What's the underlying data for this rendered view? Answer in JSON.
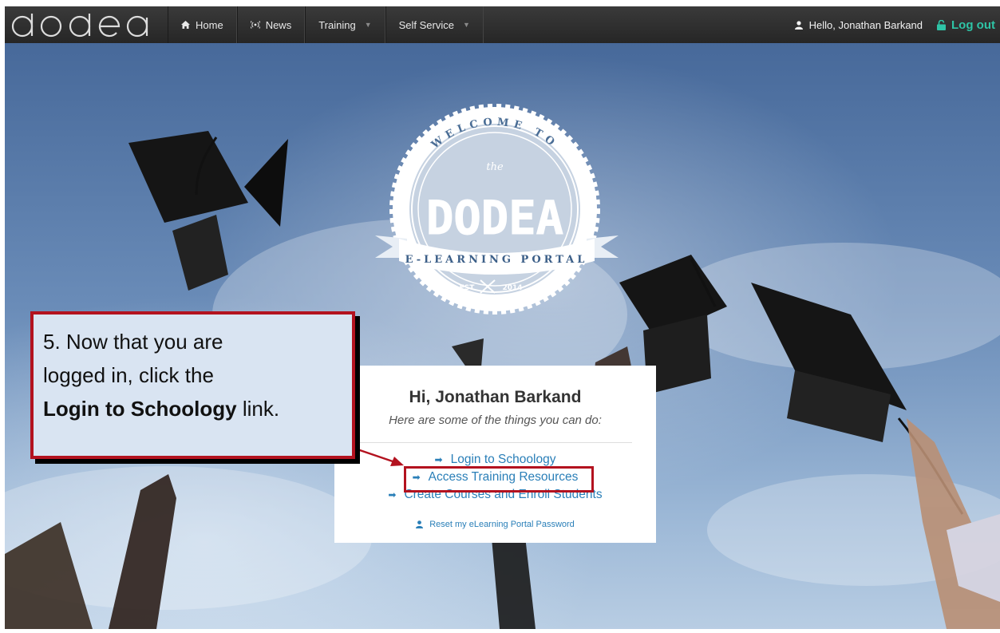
{
  "nav": {
    "brand": "dodea",
    "items": [
      {
        "label": "Home",
        "icon": "home-icon"
      },
      {
        "label": "News",
        "icon": "broadcast-icon"
      },
      {
        "label": "Training",
        "icon": "chevron-down-icon"
      },
      {
        "label": "Self Service",
        "icon": "chevron-down-icon"
      }
    ],
    "greeting": "Hello, Jonathan Barkand",
    "logout": "Log out"
  },
  "badge": {
    "top_arc": "WELCOME TO",
    "the": "the",
    "title": "DODEA",
    "ribbon": "E-LEARNING PORTAL",
    "est": "EST",
    "year": "2014"
  },
  "card": {
    "title": "Hi, Jonathan Barkand",
    "subtitle": "Here are some of the things you can do:",
    "links": [
      "Login to Schoology",
      "Access Training Resources",
      "Create Courses and Enroll Students"
    ],
    "reset": "Reset my eLearning Portal Password"
  },
  "callout": {
    "line1": "5. Now that you are",
    "line2": "logged in, click the",
    "line3_bold": "Login to Schoology",
    "line3_rest": " link."
  },
  "colors": {
    "nav_bg": "#2e2e2e",
    "logout": "#2ec4a6",
    "link": "#2a7fb8",
    "annotation_red": "#b3121f",
    "callout_bg": "#d9e4f2"
  }
}
